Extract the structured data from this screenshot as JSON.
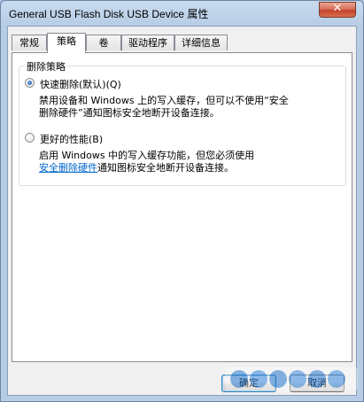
{
  "window": {
    "title": "General USB Flash Disk USB Device 属性",
    "close_glyph": "✕"
  },
  "tabs": [
    {
      "label": "常规",
      "active": false
    },
    {
      "label": "策略",
      "active": true
    },
    {
      "label": "卷",
      "active": false
    },
    {
      "label": "驱动程序",
      "active": false
    },
    {
      "label": "详细信息",
      "active": false
    }
  ],
  "group": {
    "label": "删除策略",
    "options": [
      {
        "label": "快速删除(默认)(Q)",
        "checked": true,
        "desc_line1": "禁用设备和 Windows 上的写入缓存，但可以不使用“安全",
        "desc_line2": "删除硬件”通知图标安全地断开设备连接。"
      },
      {
        "label": "更好的性能(B)",
        "checked": false,
        "desc_line1": "启用 Windows 中的写入缓存功能，但您必须使用",
        "desc_link": "安全删除硬件",
        "desc_line2_rest": "通知图标安全地断开设备连接。"
      }
    ]
  },
  "buttons": {
    "ok": "确定",
    "cancel": "取消"
  },
  "colors": {
    "accent": "#0066cc",
    "frame": "#b7cde6"
  }
}
